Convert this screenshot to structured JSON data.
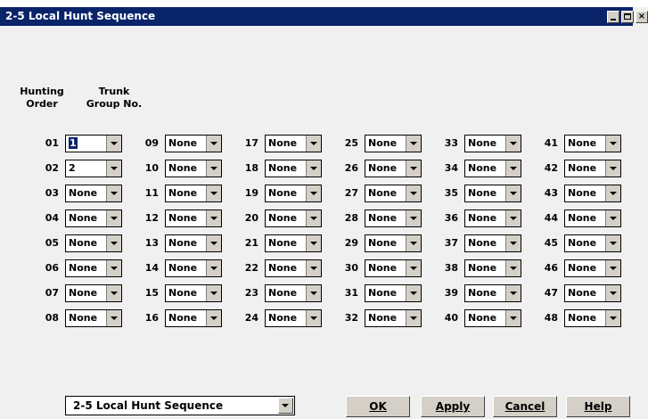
{
  "window": {
    "title": "2-5 Local Hunt Sequence"
  },
  "headers": {
    "hunting_order": "Hunting\nOrder",
    "trunk_group": "Trunk\nGroup No."
  },
  "entries": [
    {
      "order": "01",
      "value": "1"
    },
    {
      "order": "02",
      "value": "2"
    },
    {
      "order": "03",
      "value": "None"
    },
    {
      "order": "04",
      "value": "None"
    },
    {
      "order": "05",
      "value": "None"
    },
    {
      "order": "06",
      "value": "None"
    },
    {
      "order": "07",
      "value": "None"
    },
    {
      "order": "08",
      "value": "None"
    },
    {
      "order": "09",
      "value": "None"
    },
    {
      "order": "10",
      "value": "None"
    },
    {
      "order": "11",
      "value": "None"
    },
    {
      "order": "12",
      "value": "None"
    },
    {
      "order": "13",
      "value": "None"
    },
    {
      "order": "14",
      "value": "None"
    },
    {
      "order": "15",
      "value": "None"
    },
    {
      "order": "16",
      "value": "None"
    },
    {
      "order": "17",
      "value": "None"
    },
    {
      "order": "18",
      "value": "None"
    },
    {
      "order": "19",
      "value": "None"
    },
    {
      "order": "20",
      "value": "None"
    },
    {
      "order": "21",
      "value": "None"
    },
    {
      "order": "22",
      "value": "None"
    },
    {
      "order": "23",
      "value": "None"
    },
    {
      "order": "24",
      "value": "None"
    },
    {
      "order": "25",
      "value": "None"
    },
    {
      "order": "26",
      "value": "None"
    },
    {
      "order": "27",
      "value": "None"
    },
    {
      "order": "28",
      "value": "None"
    },
    {
      "order": "29",
      "value": "None"
    },
    {
      "order": "30",
      "value": "None"
    },
    {
      "order": "31",
      "value": "None"
    },
    {
      "order": "32",
      "value": "None"
    },
    {
      "order": "33",
      "value": "None"
    },
    {
      "order": "34",
      "value": "None"
    },
    {
      "order": "35",
      "value": "None"
    },
    {
      "order": "36",
      "value": "None"
    },
    {
      "order": "37",
      "value": "None"
    },
    {
      "order": "38",
      "value": "None"
    },
    {
      "order": "39",
      "value": "None"
    },
    {
      "order": "40",
      "value": "None"
    },
    {
      "order": "41",
      "value": "None"
    },
    {
      "order": "42",
      "value": "None"
    },
    {
      "order": "43",
      "value": "None"
    },
    {
      "order": "44",
      "value": "None"
    },
    {
      "order": "45",
      "value": "None"
    },
    {
      "order": "46",
      "value": "None"
    },
    {
      "order": "47",
      "value": "None"
    },
    {
      "order": "48",
      "value": "None"
    }
  ],
  "footer": {
    "screen_select": "2-5 Local Hunt Sequence",
    "ok_label": "OK",
    "apply_label": "Apply",
    "cancel_label": "Cancel",
    "help_label": "Help"
  },
  "colors": {
    "titlebar": "#0a246a",
    "dialog_bg": "#f0f0f0",
    "button_face": "#d4d0c8",
    "selection": "#0a246a"
  }
}
